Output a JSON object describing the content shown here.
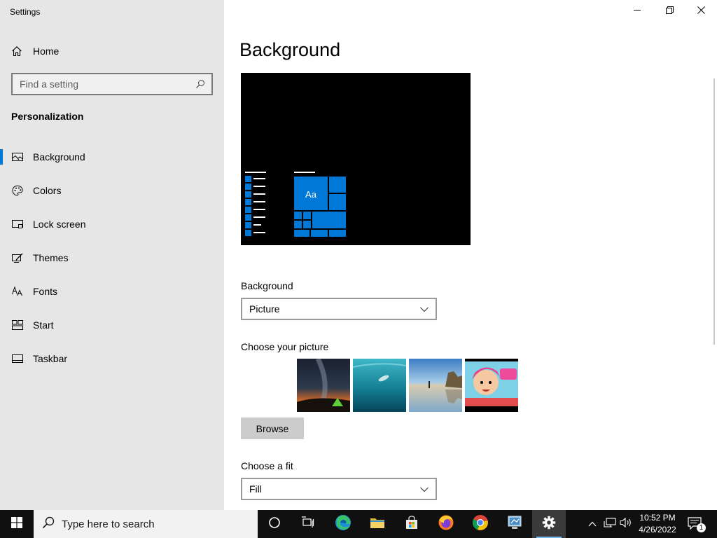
{
  "window": {
    "title": "Settings",
    "controls": {
      "minimize": "minimize",
      "restore": "restore",
      "close": "close"
    }
  },
  "sidebar": {
    "home_label": "Home",
    "search_placeholder": "Find a setting",
    "section_title": "Personalization",
    "items": [
      {
        "label": "Background",
        "icon": "picture-icon",
        "active": true
      },
      {
        "label": "Colors",
        "icon": "palette-icon",
        "active": false
      },
      {
        "label": "Lock screen",
        "icon": "lock-screen-icon",
        "active": false
      },
      {
        "label": "Themes",
        "icon": "themes-icon",
        "active": false
      },
      {
        "label": "Fonts",
        "icon": "fonts-icon",
        "active": false
      },
      {
        "label": "Start",
        "icon": "start-icon",
        "active": false
      },
      {
        "label": "Taskbar",
        "icon": "taskbar-icon",
        "active": false
      }
    ]
  },
  "main": {
    "title": "Background",
    "preview": {
      "tile_text": "Aa",
      "accent": "#0078d7"
    },
    "background_label": "Background",
    "background_value": "Picture",
    "choose_picture_label": "Choose your picture",
    "pictures": [
      "milky-way-tent",
      "underwater-swimmer",
      "beach-rocks",
      "cartoon-girl"
    ],
    "browse_label": "Browse",
    "fit_label": "Choose a fit",
    "fit_value": "Fill"
  },
  "taskbar": {
    "search_placeholder": "Type here to search",
    "apps": [
      "cortana",
      "task-view",
      "edge",
      "file-explorer",
      "store",
      "firefox",
      "chrome",
      "control-panel",
      "settings"
    ],
    "time": "10:52 PM",
    "date": "4/26/2022",
    "notification_count": "1"
  },
  "colors": {
    "accent": "#0078d7",
    "sidebar_bg": "#e6e6e6",
    "taskbar_bg": "#101010"
  }
}
